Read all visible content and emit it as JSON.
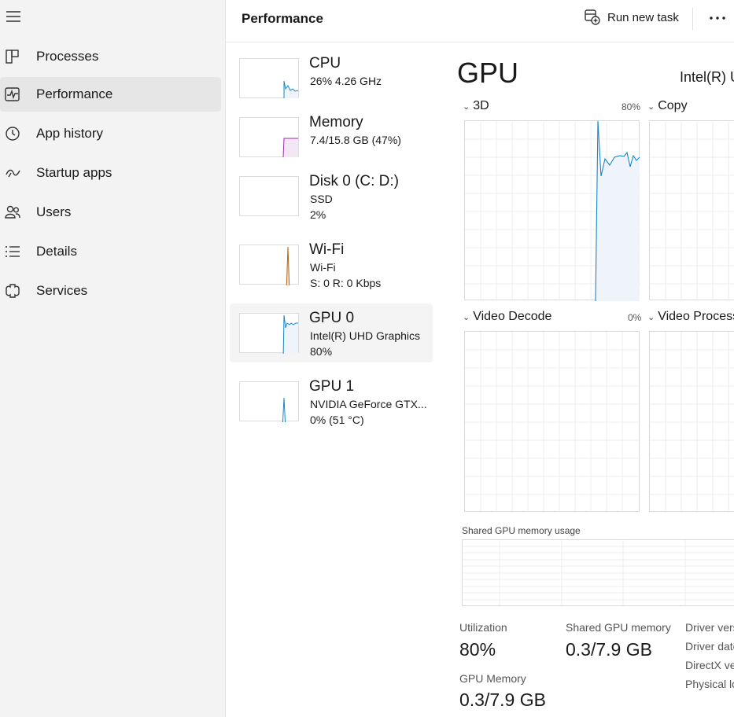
{
  "sidebar": {
    "items": [
      {
        "label": "Processes",
        "icon": "processes-icon"
      },
      {
        "label": "Performance",
        "icon": "performance-icon",
        "active": true
      },
      {
        "label": "App history",
        "icon": "history-icon"
      },
      {
        "label": "Startup apps",
        "icon": "startup-icon"
      },
      {
        "label": "Users",
        "icon": "users-icon"
      },
      {
        "label": "Details",
        "icon": "details-icon"
      },
      {
        "label": "Services",
        "icon": "services-icon"
      }
    ]
  },
  "header": {
    "title": "Performance",
    "run_new_task": "Run new task"
  },
  "devices": [
    {
      "title": "CPU",
      "line1": "26%  4.26 GHz",
      "line2": "",
      "color": "#1a86c8"
    },
    {
      "title": "Memory",
      "line1": "7.4/15.8 GB (47%)",
      "line2": "",
      "color": "#9b2fae"
    },
    {
      "title": "Disk 0 (C: D:)",
      "line1": "SSD",
      "line2": "2%",
      "color": "#4a9a2a"
    },
    {
      "title": "Wi-Fi",
      "line1": "Wi-Fi",
      "line2": "S: 0  R: 0 Kbps",
      "color": "#b5651d"
    },
    {
      "title": "GPU 0",
      "line1": "Intel(R) UHD Graphics",
      "line2": "80%",
      "color": "#1a86c8",
      "selected": true
    },
    {
      "title": "GPU 1",
      "line1": "NVIDIA GeForce GTX...",
      "line2": "0%  (51 °C)",
      "color": "#1a86c8"
    }
  ],
  "detail": {
    "heading": "GPU",
    "model": "Intel(R) UHD Graphics",
    "engines": [
      {
        "name": "3D",
        "percent": "80%"
      },
      {
        "name": "Copy",
        "percent": ""
      },
      {
        "name": "Video Decode",
        "percent": "0%"
      },
      {
        "name": "Video Processing",
        "percent": ""
      }
    ],
    "shared_memory_label": "Shared GPU memory usage",
    "stats": {
      "utilization_label": "Utilization",
      "utilization_value": "80%",
      "shared_label": "Shared GPU memory",
      "shared_value": "0.3/7.9 GB",
      "gpu_mem_label": "GPU Memory",
      "gpu_mem_value": "0.3/7.9 GB"
    },
    "info": [
      "Driver version",
      "Driver date",
      "DirectX version",
      "Physical location"
    ]
  },
  "colors": {
    "accent": "#1a86c8",
    "fill": "#eef4fa"
  }
}
